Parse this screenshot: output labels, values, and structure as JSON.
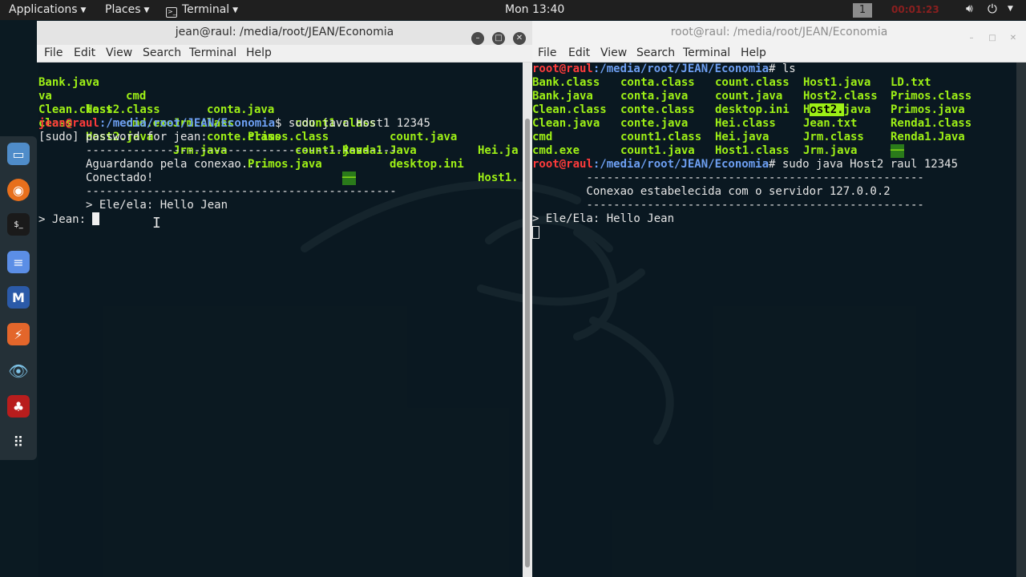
{
  "topbar": {
    "applications": "Applications",
    "places": "Places",
    "terminal": "Terminal",
    "clock": "Mon 13:40",
    "workspace": "1",
    "recording": "00:01:23",
    "volume_icon": "speaker-icon",
    "power_icon": "power-icon"
  },
  "dock": [
    {
      "name": "file-manager-icon"
    },
    {
      "name": "firefox-icon"
    },
    {
      "name": "terminal-icon"
    },
    {
      "name": "text-editor-icon"
    },
    {
      "name": "metasploit-icon"
    },
    {
      "name": "burpsuite-icon"
    },
    {
      "name": "eye-icon"
    },
    {
      "name": "cherrytree-icon"
    },
    {
      "name": "app-grid-icon"
    }
  ],
  "left": {
    "title": "jean@raul: /media/root/JEAN/Economia",
    "menu": [
      "File",
      "Edit",
      "View",
      "Search",
      "Terminal",
      "Help"
    ],
    "row1": [
      "Bank.java",
      "cmd",
      "conta.java",
      "count1.class",
      "count.java",
      "Hei.ja"
    ],
    "row2": [
      "va",
      "Host2.class",
      "Jrm.class",
      "Primos.class",
      "Renda1.Java"
    ],
    "row3": [
      "Clean.class",
      "cmd.exe",
      "conte.class",
      "count1.java",
      "desktop.ini",
      "Host1."
    ],
    "row4": [
      "class",
      "Host2.java",
      "Jrm.java",
      "Primos.java",
      "──"
    ],
    "prompt_user": "jean@raul",
    "prompt_path": ":/media/root/JEAN/Economia",
    "prompt_cmd": "$ sudo java Host1 12345",
    "sudo_line": "[sudo] password for jean:",
    "dash": "       ----------------------------------------------",
    "waiting": "       Aguardando pela conexao...",
    "connected": "       Conectado!",
    "dash2": "       ----------------------------------------------",
    "received": "       > Ele/ela: Hello Jean",
    "input_prompt": "> Jean: "
  },
  "right": {
    "title": "root@raul: /media/root/JEAN/Economia",
    "menu": [
      "File",
      "Edit",
      "View",
      "Search",
      "Terminal",
      "Help"
    ],
    "prompt_user": "root@raul",
    "prompt_path": ":/media/root/JEAN/Economia",
    "prompt_cmd1": "# ls",
    "ls_rows": [
      [
        "Bank.class",
        "conta.class",
        "count.class",
        "Host1.java",
        "LD.txt"
      ],
      [
        "Bank.java",
        "conta.java",
        "count.java",
        "Host2.class",
        "Primos.class"
      ],
      [
        "Clean.class",
        "conte.class",
        "desktop.ini",
        "Host2.java",
        "Primos.java"
      ],
      [
        "Clean.java",
        "conte.java",
        "Hei.class",
        "Jean.txt",
        "Renda1.class"
      ],
      [
        "cmd",
        "count1.class",
        "Hei.java",
        "Jrm.class",
        "Renda1.Java"
      ],
      [
        "cmd.exe",
        "count1.java",
        "Host1.class",
        "Jrm.java",
        "──"
      ]
    ],
    "prompt_cmd2": "# sudo java Host2 raul 12345",
    "dash": "        --------------------------------------------------",
    "established": "        Conexao estabelecida com o servidor 127.0.0.2",
    "dash2": "        --------------------------------------------------",
    "received": "> Ele/Ela: Hello Jean"
  }
}
